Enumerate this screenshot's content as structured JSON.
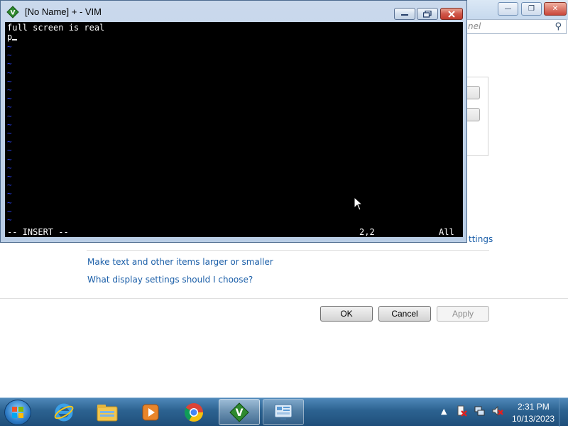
{
  "background_window": {
    "search_placeholder": "nel",
    "settings_link_partial": "ttings",
    "links": [
      "Make text and other items larger or smaller",
      "What display settings should I choose?"
    ],
    "buttons": {
      "ok": "OK",
      "cancel": "Cancel",
      "apply": "Apply"
    }
  },
  "vim": {
    "title": "[No Name] + - VIM",
    "lines": [
      "full screen is real",
      "p"
    ],
    "tilde_char": "~",
    "status": {
      "mode": "-- INSERT --",
      "position": "2,2",
      "scroll": "All"
    }
  },
  "taskbar": {
    "items": [
      {
        "name": "internet-explorer-icon"
      },
      {
        "name": "windows-explorer-icon"
      },
      {
        "name": "media-player-icon"
      },
      {
        "name": "chrome-icon"
      },
      {
        "name": "vim-icon",
        "active": true
      },
      {
        "name": "control-panel-icon",
        "open": true
      }
    ],
    "clock": {
      "time": "2:31 PM",
      "date": "10/13/2023"
    }
  },
  "colors": {
    "taskbar": "#2c6290",
    "link": "#1a5ea8",
    "vim_background": "#000000",
    "vim_tilde": "#2b45ff"
  }
}
